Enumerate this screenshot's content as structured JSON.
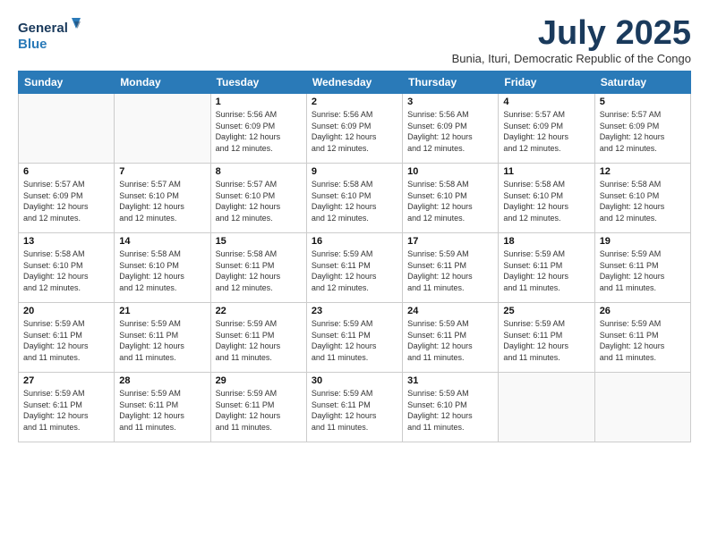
{
  "logo": {
    "line1": "General",
    "line2": "Blue"
  },
  "title": "July 2025",
  "subtitle": "Bunia, Ituri, Democratic Republic of the Congo",
  "weekdays": [
    "Sunday",
    "Monday",
    "Tuesday",
    "Wednesday",
    "Thursday",
    "Friday",
    "Saturday"
  ],
  "weeks": [
    [
      {
        "day": "",
        "info": ""
      },
      {
        "day": "",
        "info": ""
      },
      {
        "day": "1",
        "sunrise": "5:56 AM",
        "sunset": "6:09 PM",
        "daylight": "12 hours and 12 minutes."
      },
      {
        "day": "2",
        "sunrise": "5:56 AM",
        "sunset": "6:09 PM",
        "daylight": "12 hours and 12 minutes."
      },
      {
        "day": "3",
        "sunrise": "5:56 AM",
        "sunset": "6:09 PM",
        "daylight": "12 hours and 12 minutes."
      },
      {
        "day": "4",
        "sunrise": "5:57 AM",
        "sunset": "6:09 PM",
        "daylight": "12 hours and 12 minutes."
      },
      {
        "day": "5",
        "sunrise": "5:57 AM",
        "sunset": "6:09 PM",
        "daylight": "12 hours and 12 minutes."
      }
    ],
    [
      {
        "day": "6",
        "sunrise": "5:57 AM",
        "sunset": "6:09 PM",
        "daylight": "12 hours and 12 minutes."
      },
      {
        "day": "7",
        "sunrise": "5:57 AM",
        "sunset": "6:10 PM",
        "daylight": "12 hours and 12 minutes."
      },
      {
        "day": "8",
        "sunrise": "5:57 AM",
        "sunset": "6:10 PM",
        "daylight": "12 hours and 12 minutes."
      },
      {
        "day": "9",
        "sunrise": "5:58 AM",
        "sunset": "6:10 PM",
        "daylight": "12 hours and 12 minutes."
      },
      {
        "day": "10",
        "sunrise": "5:58 AM",
        "sunset": "6:10 PM",
        "daylight": "12 hours and 12 minutes."
      },
      {
        "day": "11",
        "sunrise": "5:58 AM",
        "sunset": "6:10 PM",
        "daylight": "12 hours and 12 minutes."
      },
      {
        "day": "12",
        "sunrise": "5:58 AM",
        "sunset": "6:10 PM",
        "daylight": "12 hours and 12 minutes."
      }
    ],
    [
      {
        "day": "13",
        "sunrise": "5:58 AM",
        "sunset": "6:10 PM",
        "daylight": "12 hours and 12 minutes."
      },
      {
        "day": "14",
        "sunrise": "5:58 AM",
        "sunset": "6:10 PM",
        "daylight": "12 hours and 12 minutes."
      },
      {
        "day": "15",
        "sunrise": "5:58 AM",
        "sunset": "6:11 PM",
        "daylight": "12 hours and 12 minutes."
      },
      {
        "day": "16",
        "sunrise": "5:59 AM",
        "sunset": "6:11 PM",
        "daylight": "12 hours and 12 minutes."
      },
      {
        "day": "17",
        "sunrise": "5:59 AM",
        "sunset": "6:11 PM",
        "daylight": "12 hours and 11 minutes."
      },
      {
        "day": "18",
        "sunrise": "5:59 AM",
        "sunset": "6:11 PM",
        "daylight": "12 hours and 11 minutes."
      },
      {
        "day": "19",
        "sunrise": "5:59 AM",
        "sunset": "6:11 PM",
        "daylight": "12 hours and 11 minutes."
      }
    ],
    [
      {
        "day": "20",
        "sunrise": "5:59 AM",
        "sunset": "6:11 PM",
        "daylight": "12 hours and 11 minutes."
      },
      {
        "day": "21",
        "sunrise": "5:59 AM",
        "sunset": "6:11 PM",
        "daylight": "12 hours and 11 minutes."
      },
      {
        "day": "22",
        "sunrise": "5:59 AM",
        "sunset": "6:11 PM",
        "daylight": "12 hours and 11 minutes."
      },
      {
        "day": "23",
        "sunrise": "5:59 AM",
        "sunset": "6:11 PM",
        "daylight": "12 hours and 11 minutes."
      },
      {
        "day": "24",
        "sunrise": "5:59 AM",
        "sunset": "6:11 PM",
        "daylight": "12 hours and 11 minutes."
      },
      {
        "day": "25",
        "sunrise": "5:59 AM",
        "sunset": "6:11 PM",
        "daylight": "12 hours and 11 minutes."
      },
      {
        "day": "26",
        "sunrise": "5:59 AM",
        "sunset": "6:11 PM",
        "daylight": "12 hours and 11 minutes."
      }
    ],
    [
      {
        "day": "27",
        "sunrise": "5:59 AM",
        "sunset": "6:11 PM",
        "daylight": "12 hours and 11 minutes."
      },
      {
        "day": "28",
        "sunrise": "5:59 AM",
        "sunset": "6:11 PM",
        "daylight": "12 hours and 11 minutes."
      },
      {
        "day": "29",
        "sunrise": "5:59 AM",
        "sunset": "6:11 PM",
        "daylight": "12 hours and 11 minutes."
      },
      {
        "day": "30",
        "sunrise": "5:59 AM",
        "sunset": "6:11 PM",
        "daylight": "12 hours and 11 minutes."
      },
      {
        "day": "31",
        "sunrise": "5:59 AM",
        "sunset": "6:10 PM",
        "daylight": "12 hours and 11 minutes."
      },
      {
        "day": "",
        "info": ""
      },
      {
        "day": "",
        "info": ""
      }
    ]
  ]
}
